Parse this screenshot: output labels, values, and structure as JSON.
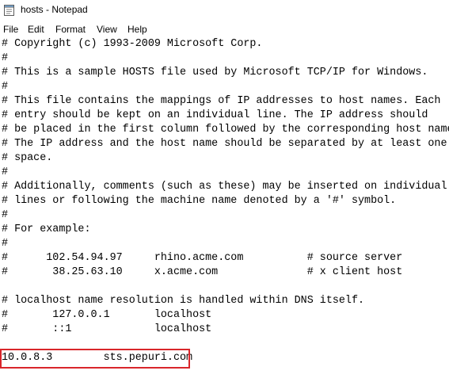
{
  "window": {
    "title": "hosts - Notepad",
    "app_icon": "notepad-icon"
  },
  "menu": {
    "items": [
      "File",
      "Edit",
      "Format",
      "View",
      "Help"
    ]
  },
  "editor": {
    "lines": [
      "# Copyright (c) 1993-2009 Microsoft Corp.",
      "#",
      "# This is a sample HOSTS file used by Microsoft TCP/IP for Windows.",
      "#",
      "# This file contains the mappings of IP addresses to host names. Each",
      "# entry should be kept on an individual line. The IP address should",
      "# be placed in the first column followed by the corresponding host name.",
      "# The IP address and the host name should be separated by at least one",
      "# space.",
      "#",
      "# Additionally, comments (such as these) may be inserted on individual",
      "# lines or following the machine name denoted by a '#' symbol.",
      "#",
      "# For example:",
      "#",
      "#      102.54.94.97     rhino.acme.com          # source server",
      "#       38.25.63.10     x.acme.com              # x client host",
      "",
      "# localhost name resolution is handled within DNS itself.",
      "#       127.0.0.1       localhost",
      "#       ::1             localhost",
      "",
      "10.0.8.3        sts.pepuri.com"
    ],
    "highlight_color": "#d9262b"
  }
}
